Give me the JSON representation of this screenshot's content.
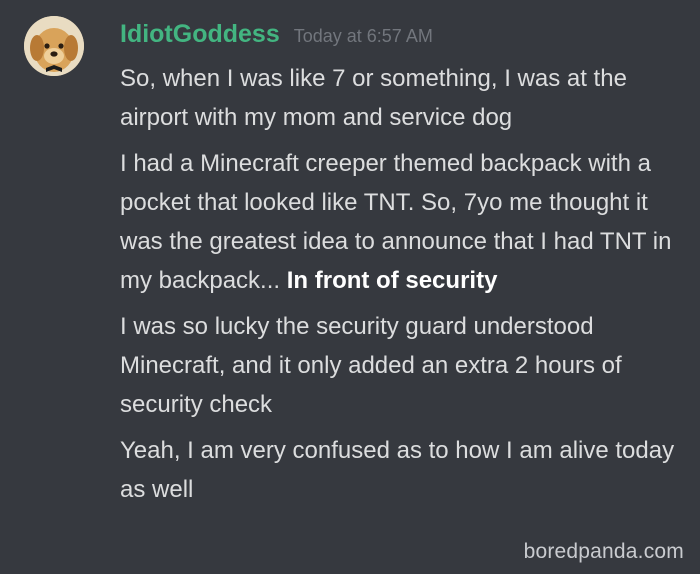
{
  "message": {
    "username": "IdiotGoddess",
    "timestamp": "Today at 6:57 AM",
    "lines": [
      "So, when I was like 7 or something, I was at the airport with my mom and service dog",
      "I had a Minecraft creeper themed backpack with a pocket that looked like TNT. So, 7yo me thought it was the greatest idea to announce that I had TNT in my backpack...",
      "In front of security",
      "I was so lucky the security guard understood Minecraft, and it only added an extra 2 hours of security check",
      "Yeah, I am very confused as to how I am alive today as well"
    ]
  },
  "avatar_icon": "golden-retriever-puppy-avatar",
  "watermark": "boredpanda.com",
  "colors": {
    "background": "#36393f",
    "username": "#43b581",
    "timestamp": "#72767d",
    "text": "#dcddde"
  }
}
